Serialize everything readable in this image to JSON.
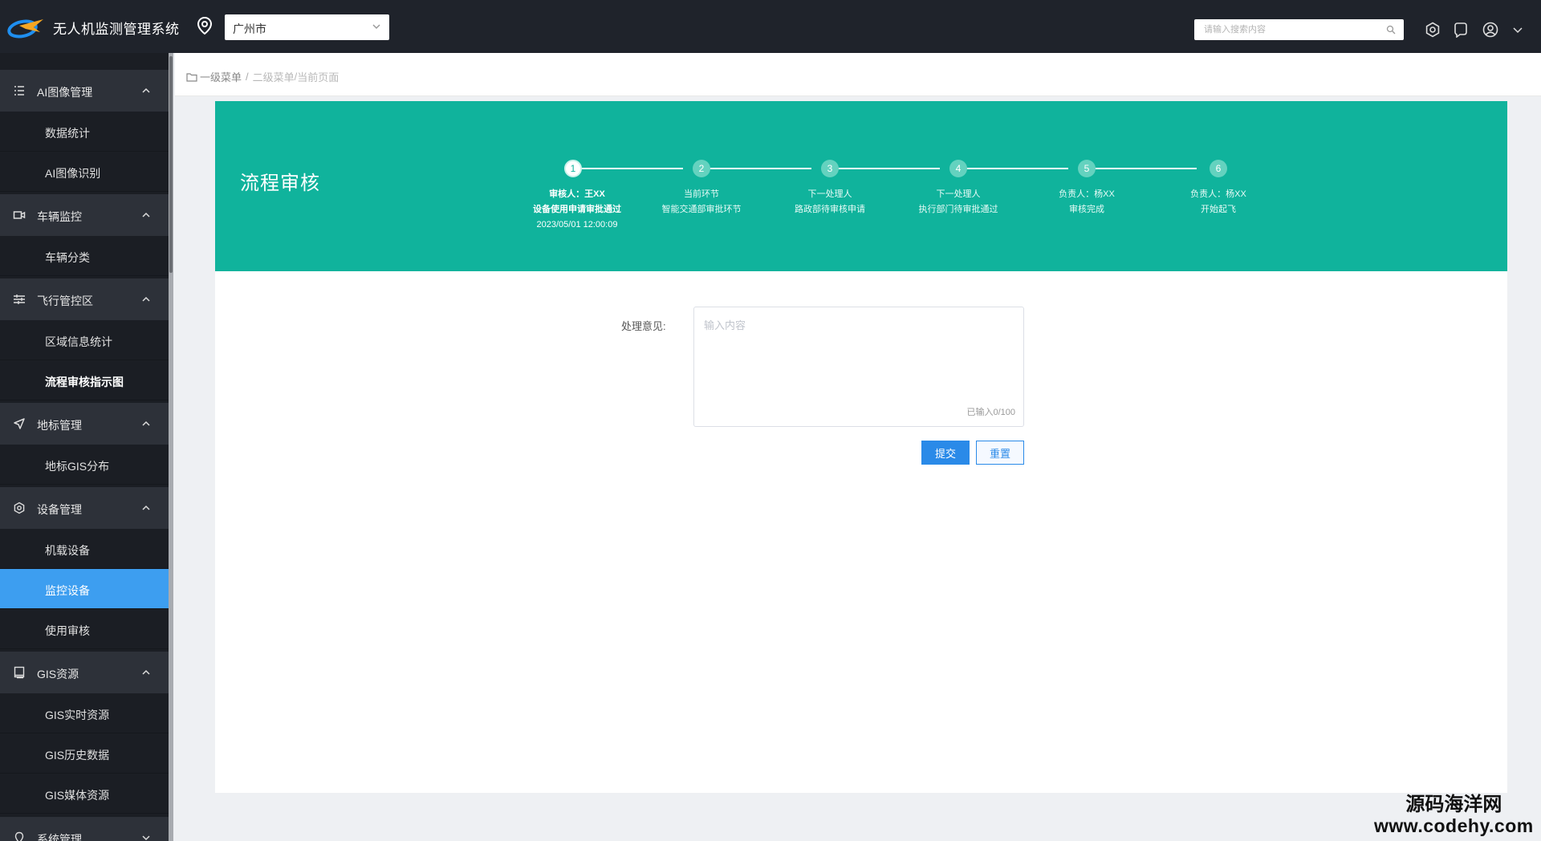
{
  "app": {
    "title": "无人机监测管理系统"
  },
  "topbar": {
    "city": "广州市",
    "search_placeholder": "请输入搜索内容"
  },
  "sidebar": {
    "groups": [
      {
        "label": "AI图像管理",
        "icon": "list-icon",
        "items": [
          "数据统计",
          "AI图像识别"
        ]
      },
      {
        "label": "车辆监控",
        "icon": "video-camera-icon",
        "items": [
          "车辆分类"
        ]
      },
      {
        "label": "飞行管控区",
        "icon": "sliders-icon",
        "items": [
          "区域信息统计",
          "流程审核指示图"
        ]
      },
      {
        "label": "地标管理",
        "icon": "navigation-icon",
        "items": [
          "地标GIS分布"
        ]
      },
      {
        "label": "设备管理",
        "icon": "settings-hex-icon",
        "items": [
          "机载设备",
          "监控设备",
          "使用审核"
        ]
      },
      {
        "label": "GIS资源",
        "icon": "book-icon",
        "items": [
          "GIS实时资源",
          "GIS历史数据",
          "GIS媒体资源"
        ]
      },
      {
        "label": "系统管理",
        "icon": "location-icon",
        "items": []
      }
    ],
    "active_item": "监控设备",
    "current_page_item": "流程审核指示图"
  },
  "breadcrumb": {
    "level1": "一级菜单",
    "level2": "二级菜单",
    "current": "当前页面"
  },
  "banner": {
    "title": "流程审核",
    "steps": [
      {
        "num": "1",
        "line1": "审核人：王XX",
        "line2": "设备使用申请审批通过",
        "line3": "2023/05/01  12:00:09"
      },
      {
        "num": "2",
        "line1": "当前环节",
        "line2": "智能交通部审批环节",
        "line3": ""
      },
      {
        "num": "3",
        "line1": "下一处理人",
        "line2": "路政部待审核申请",
        "line3": ""
      },
      {
        "num": "4",
        "line1": "下一处理人",
        "line2": "执行部门待审批通过",
        "line3": ""
      },
      {
        "num": "5",
        "line1": "负责人：杨XX",
        "line2": "审核完成",
        "line3": ""
      },
      {
        "num": "6",
        "line1": "负责人：杨XX",
        "line2": "开始起飞",
        "line3": ""
      }
    ],
    "current_step": 1
  },
  "form": {
    "label": "处理意见:",
    "placeholder": "输入内容",
    "counter": "已输入0/100",
    "submit_label": "提交",
    "reset_label": "重置"
  },
  "watermark": {
    "line1": "源码海洋网",
    "line2": "www.codehy.com"
  },
  "colors": {
    "banner": "#10b39c",
    "sidebar_active": "#3d9ef0",
    "topbar": "#1f232b",
    "primary_button": "#2a8ae8"
  }
}
